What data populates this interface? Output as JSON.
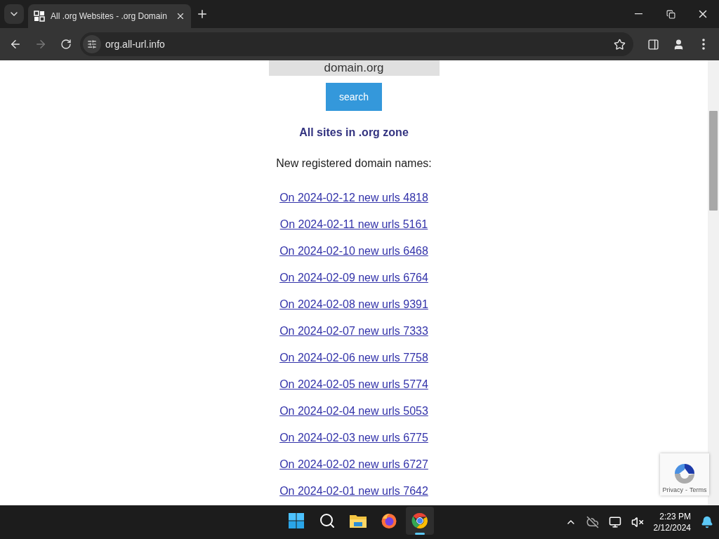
{
  "browser": {
    "tab": {
      "title": "All .org Websites - .org Domain",
      "selected": true
    },
    "address": "org.all-url.info"
  },
  "page": {
    "search_field": {
      "value": "domain.org"
    },
    "search_button": "search",
    "heading": "All sites in .org zone",
    "subheading": "New registered domain names:",
    "links": [
      "On 2024-02-12 new urls 4818",
      "On 2024-02-11 new urls 5161",
      "On 2024-02-10 new urls 6468",
      "On 2024-02-09 new urls 6764",
      "On 2024-02-08 new urls 9391",
      "On 2024-02-07 new urls 7333",
      "On 2024-02-06 new urls 7758",
      "On 2024-02-05 new urls 5774",
      "On 2024-02-04 new urls 5053",
      "On 2024-02-03 new urls 6775",
      "On 2024-02-02 new urls 6727",
      "On 2024-02-01 new urls 7642"
    ],
    "recaptcha": {
      "privacy": "Privacy",
      "separator": "-",
      "terms": "Terms"
    }
  },
  "taskbar": {
    "apps": [
      {
        "kind": "start",
        "selected": false
      },
      {
        "kind": "search",
        "selected": false
      },
      {
        "kind": "files",
        "selected": false
      },
      {
        "kind": "firefox",
        "selected": false
      },
      {
        "kind": "chrome",
        "selected": true
      }
    ],
    "time": "2:23 PM",
    "date": "2/12/2024"
  }
}
